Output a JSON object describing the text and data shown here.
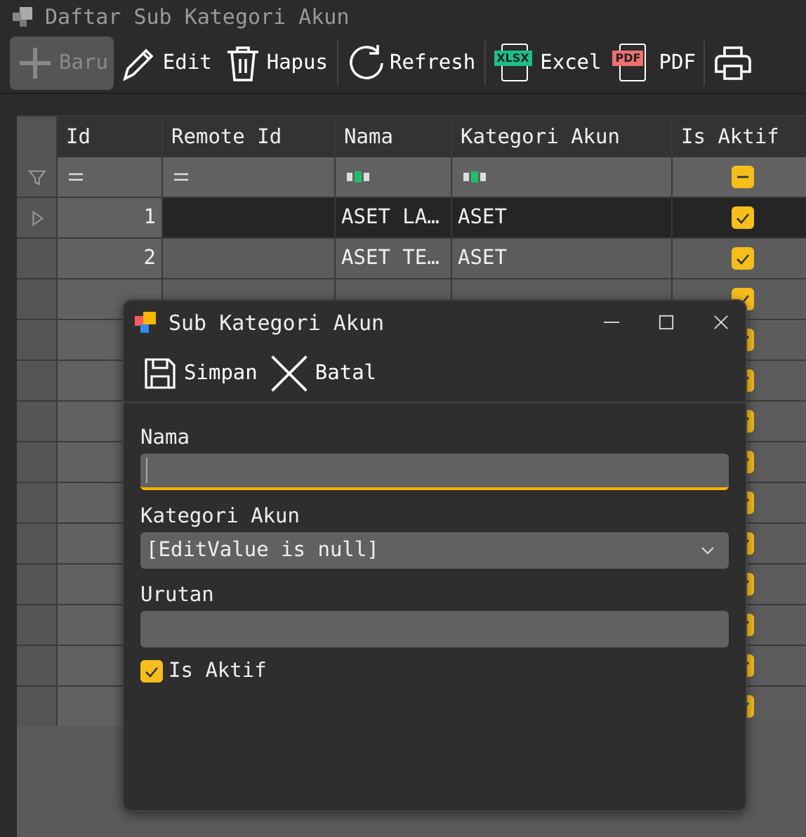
{
  "window": {
    "title": "Daftar Sub Kategori Akun"
  },
  "toolbar": [
    {
      "label": "Baru",
      "kind": "plus",
      "disabled": true,
      "separator_before": false
    },
    {
      "label": "Edit",
      "kind": "pencil",
      "disabled": false,
      "separator_before": false
    },
    {
      "label": "Hapus",
      "kind": "trash",
      "disabled": false,
      "separator_before": false
    },
    {
      "label": "Refresh",
      "kind": "refresh",
      "disabled": false,
      "separator_before": true
    },
    {
      "label": "Excel",
      "kind": "xlsx",
      "badge": "XLSX",
      "disabled": false,
      "separator_before": true
    },
    {
      "label": "PDF",
      "kind": "pdf",
      "badge": "PDF",
      "disabled": false,
      "separator_before": false
    },
    {
      "kind": "printer",
      "disabled": false,
      "separator_before": true
    }
  ],
  "grid": {
    "columns": [
      "Id",
      "Remote Id",
      "Nama",
      "Kategori Akun",
      "Is Aktif"
    ],
    "filters": [
      {
        "kind": "equals"
      },
      {
        "kind": "equals"
      },
      {
        "kind": "text"
      },
      {
        "kind": "text"
      },
      {
        "kind": "checkbox",
        "indeterminate": true
      }
    ],
    "rows": [
      {
        "id": "1",
        "nama": "ASET LA…",
        "kategori": "ASET",
        "aktif": true,
        "selected": true
      },
      {
        "id": "2",
        "nama": "ASET TE…",
        "kategori": "ASET",
        "aktif": true,
        "selected": false
      },
      {
        "aktif": true,
        "selected": false
      },
      {
        "aktif": true,
        "selected": false
      },
      {
        "aktif": true,
        "selected": false
      },
      {
        "aktif": true,
        "selected": false
      },
      {
        "aktif": true,
        "selected": false
      },
      {
        "aktif": true,
        "selected": false
      },
      {
        "aktif": true,
        "selected": false
      },
      {
        "aktif": true,
        "selected": false
      },
      {
        "aktif": true,
        "selected": false
      },
      {
        "aktif": true,
        "selected": false
      },
      {
        "aktif": true,
        "selected": false
      }
    ]
  },
  "dialog": {
    "title": "Sub Kategori Akun",
    "toolbar": [
      {
        "label": "Simpan",
        "kind": "save"
      },
      {
        "label": "Batal",
        "kind": "close"
      }
    ],
    "fields": [
      {
        "kind": "text",
        "label": "Nama",
        "focused": true
      },
      {
        "kind": "dropdown",
        "label": "Kategori Akun",
        "value": "[EditValue is null]"
      },
      {
        "kind": "text",
        "label": "Urutan",
        "focused": false
      }
    ],
    "checkbox": {
      "label": "Is Aktif",
      "checked": true
    }
  }
}
